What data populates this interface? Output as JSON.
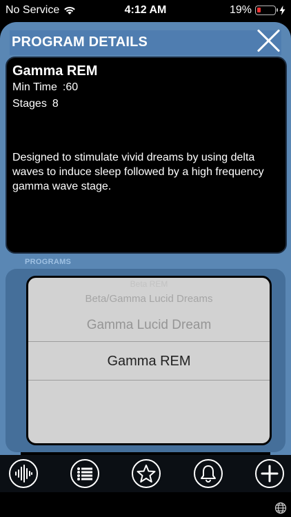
{
  "status_bar": {
    "carrier": "No Service",
    "time": "4:12 AM",
    "battery_percent": "19%",
    "battery_level": 0.19,
    "icons": [
      "wifi-icon",
      "battery-icon",
      "charging-bolt-icon"
    ]
  },
  "header": {
    "title": "PROGRAM DETAILS",
    "close_icon": "close-icon"
  },
  "program": {
    "name": "Gamma REM",
    "min_time_label": "Min Time",
    "min_time_value": ":60",
    "stages_label": "Stages",
    "stages_value": "8",
    "description": "Designed to stimulate vivid dreams by using delta waves to induce sleep followed by a high frequency gamma wave stage."
  },
  "programs_section": {
    "label": "PROGRAMS",
    "options": [
      "Beta REM",
      "Beta/Gamma Lucid Dreams",
      "Gamma Lucid Dream",
      "Gamma REM"
    ],
    "selected": "Gamma REM"
  },
  "tabbar": {
    "tabs": [
      "waveform-icon",
      "list-icon",
      "star-icon",
      "bell-icon",
      "plus-icon"
    ]
  },
  "colors": {
    "frame": "#5a87b4",
    "picker_bg": "#d2d2d2",
    "background": "#000000"
  }
}
